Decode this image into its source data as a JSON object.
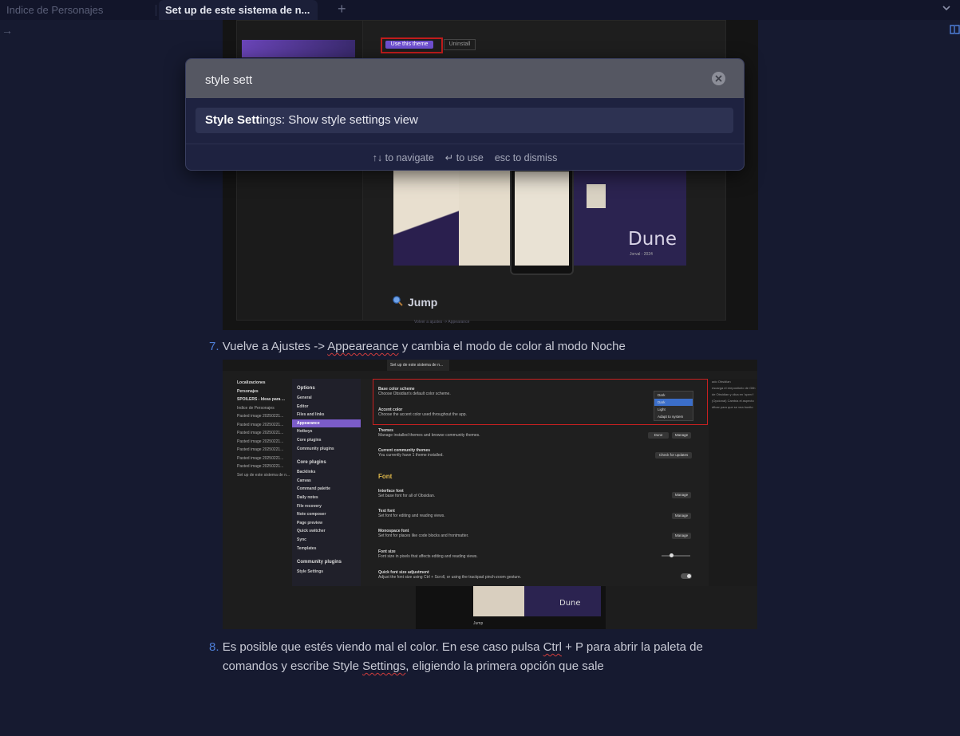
{
  "tabs": [
    {
      "label": "Indice de Personajes",
      "active": false
    },
    {
      "label": "Set up de este sistema de n...",
      "active": true
    }
  ],
  "tabbar": {
    "new_tab_glyph": "+",
    "menu_icon": "chevron-down-icon"
  },
  "nav": {
    "back_glyph": "→"
  },
  "screenshot1": {
    "use_theme": "Use this theme",
    "uninstall": "Uninstall",
    "dune": "Dune",
    "dune_sub": "Jorval - 2024",
    "jump": "Jump",
    "caption": "Volver a ajustes -> Appearance"
  },
  "step7": {
    "number": "7.",
    "text_before": "Vuelve a Ajustes -> ",
    "misspelled": "Appeareance",
    "text_after": " y cambia el modo de color al modo Noche"
  },
  "screenshot2": {
    "tab": "Set up de este sistema de n...",
    "filetree": [
      "Localizaciones",
      "Personajes",
      "SPOILERS - Ideas para ...",
      "Indice de Personajes",
      "Pasted image 20250221...",
      "Pasted image 20250221...",
      "Pasted image 20250221...",
      "Pasted image 20250221...",
      "Pasted image 20250221...",
      "Pasted image 20250221...",
      "Pasted image 20250221...",
      "Set up de este sistema de n..."
    ],
    "options_head": "Options",
    "options": [
      "General",
      "Editor",
      "Files and links",
      "Appearance",
      "Hotkeys",
      "Core plugins",
      "Community plugins"
    ],
    "selected_option": "Appearance",
    "core_head": "Core plugins",
    "core": [
      "Backlinks",
      "Canvas",
      "Command palette",
      "Daily notes",
      "File recovery",
      "Note composer",
      "Page preview",
      "Quick switcher",
      "Sync",
      "Templates"
    ],
    "community_head": "Community plugins",
    "community": [
      "Style Settings"
    ],
    "settings": [
      {
        "title": "Base color scheme",
        "desc": "Choose Obsidian's default color scheme."
      },
      {
        "title": "Accent color",
        "desc": "Choose the accent color used throughout the app."
      },
      {
        "title": "Themes",
        "desc": "Manage installed themes and browse community themes."
      },
      {
        "title": "Current community themes",
        "desc": "You currently have 1 theme installed."
      },
      {
        "title": "Interface font",
        "desc": "Set base font for all of Obsidian."
      },
      {
        "title": "Text font",
        "desc": "Set font for editing and reading views."
      },
      {
        "title": "Monospace font",
        "desc": "Set font for places like code blocks and frontmatter."
      },
      {
        "title": "Font size",
        "desc": "Font size in pixels that affects editing and reading views."
      },
      {
        "title": "Quick font size adjustment",
        "desc": "Adjust the font size using Ctrl + Scroll, or using the trackpad pinch-zoom gesture."
      }
    ],
    "font_section": "Font",
    "dropdown": {
      "current": "Dark",
      "options": [
        "Dark",
        "Light",
        "Adapt to system"
      ],
      "selected": "Dark"
    },
    "themes_value": "Dune",
    "buttons": {
      "manage": "Manage",
      "check_updates": "Check for updates"
    },
    "side_lines": [
      "ado Obsidian",
      "escarga el reepositorio de Gith",
      "de Obsidian y clica en 'open f",
      "(Opcional) Cambia el aspecto",
      "dficar para que se vea bonito"
    ],
    "bottom_dune": "Dune",
    "bottom_jump": "Jump"
  },
  "step8": {
    "number": "8.",
    "line1_a": "Es posible que estés viendo mal el color. En ese caso pulsa ",
    "line1_b": "Ctrl",
    "line1_c": " + P para abrir la paleta de",
    "line2_a": "comandos y escribe Style ",
    "line2_b": "Settings",
    "line2_c": ", eligiendo la primera opción que sale"
  },
  "palette": {
    "query": "style sett",
    "clear_icon": "close-circle-icon",
    "result_match": "Style Sett",
    "result_rest": "ings: Show style settings view",
    "footer": [
      {
        "key": "↑↓",
        "label": "to navigate"
      },
      {
        "key": "↵",
        "label": "to use"
      },
      {
        "key": "esc",
        "label": "to dismiss"
      }
    ]
  }
}
